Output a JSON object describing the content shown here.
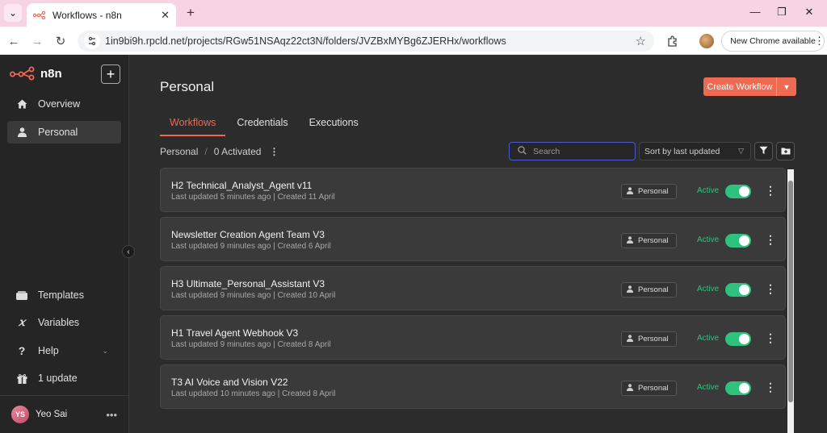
{
  "browser": {
    "tab_title": "Workflows - n8n",
    "url": "1in9bi9h.rpcld.net/projects/RGw51NSAqz22ct3N/folders/JVZBxMYBg6ZJERHx/workflows",
    "update_label": "New Chrome available",
    "icons": [
      "tab-search-icon",
      "close-icon",
      "plus-icon",
      "minimize-icon",
      "maximize-icon",
      "close-window-icon",
      "back-icon",
      "forward-icon",
      "reload-icon",
      "site-info-icon",
      "star-icon",
      "extensions-icon"
    ]
  },
  "sidebar": {
    "logo_text": "n8n",
    "top_items": [
      {
        "label": "Overview",
        "icon": "home-icon"
      },
      {
        "label": "Personal",
        "icon": "user-icon"
      }
    ],
    "bottom_items": [
      {
        "label": "Templates",
        "icon": "templates-icon"
      },
      {
        "label": "Variables",
        "icon": "variables-icon"
      },
      {
        "label": "Help",
        "icon": "question-icon"
      },
      {
        "label": "1 update",
        "icon": "gift-icon"
      }
    ],
    "user": {
      "initials": "YS",
      "name": "Yeo Sai"
    }
  },
  "main": {
    "title": "Personal",
    "create_label": "Create Workflow",
    "tabs": [
      "Workflows",
      "Credentials",
      "Executions"
    ],
    "breadcrumb": {
      "project": "Personal",
      "activated": "0 Activated"
    },
    "search_placeholder": "Search",
    "sort_label": "Sort by last updated",
    "workflows": [
      {
        "name": "H2 Technical_Analyst_Agent v11",
        "meta": "Last updated 5 minutes ago | Created 11 April",
        "owner": "Personal",
        "status": "Active"
      },
      {
        "name": "Newsletter Creation Agent Team V3",
        "meta": "Last updated 9 minutes ago | Created 6 April",
        "owner": "Personal",
        "status": "Active"
      },
      {
        "name": "H3 Ultimate_Personal_Assistant V3",
        "meta": "Last updated 9 minutes ago | Created 10 April",
        "owner": "Personal",
        "status": "Active"
      },
      {
        "name": "H1 Travel Agent Webhook V3",
        "meta": "Last updated 9 minutes ago | Created 8 April",
        "owner": "Personal",
        "status": "Active"
      },
      {
        "name": "T3 AI Voice and Vision V22",
        "meta": "Last updated 10 minutes ago | Created 8 April",
        "owner": "Personal",
        "status": "Active"
      }
    ]
  },
  "colors": {
    "accent": "#ee6a53",
    "active_green": "#2ec27e",
    "focus_blue": "#4a5ad0"
  }
}
